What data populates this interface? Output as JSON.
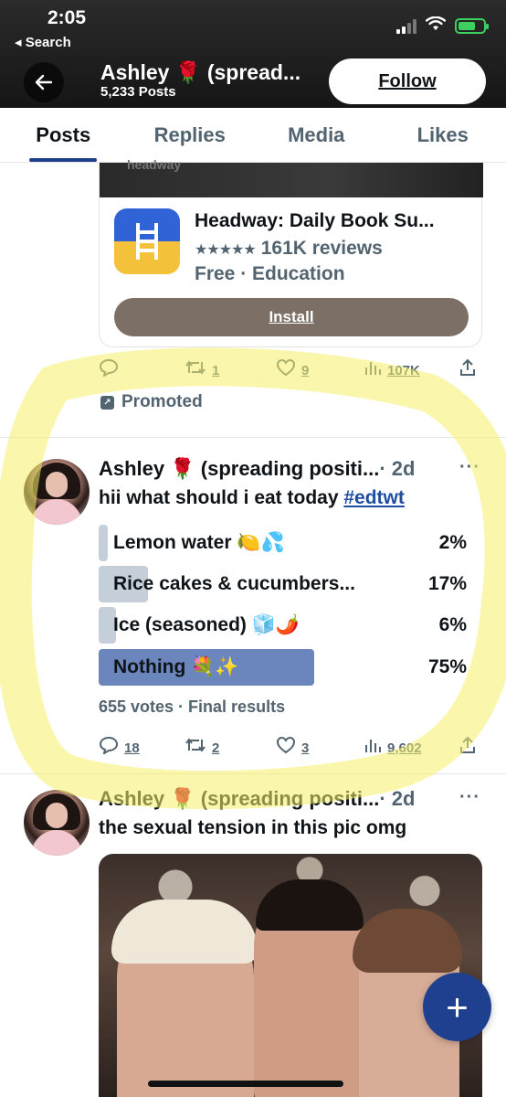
{
  "status_bar": {
    "time": "2:05",
    "back_label": "◂ Search"
  },
  "header": {
    "profile_name": "Ashley 🌹 (spread...",
    "post_count": "5,233 Posts",
    "follow_label": "Follow"
  },
  "tabs": [
    {
      "label": "Posts",
      "active": true
    },
    {
      "label": "Replies",
      "active": false
    },
    {
      "label": "Media",
      "active": false
    },
    {
      "label": "Likes",
      "active": false
    }
  ],
  "ad": {
    "media_label": "headway",
    "app_title": "Headway: Daily Book Su...",
    "rating_stars": "★★★★★",
    "rating_text": "161K reviews",
    "meta": "Free · Education",
    "install_label": "Install",
    "actions": {
      "reposts": "1",
      "likes": "9",
      "views": "107K"
    },
    "promoted_label": "Promoted"
  },
  "tweets": [
    {
      "name": "Ashley 🌹 (spreading positi...",
      "time": "· 2d",
      "more": "···",
      "text": "hii what should i eat today ",
      "hashtag": "#edtwt",
      "poll": {
        "options": [
          {
            "label": "Lemon water 🍋💦",
            "percent": "2%",
            "fraction": 0.02,
            "winner": false
          },
          {
            "label": "Rice cakes & cucumbers...",
            "percent": "17%",
            "fraction": 0.17,
            "winner": false
          },
          {
            "label": "Ice (seasoned) 🧊🌶️",
            "percent": "6%",
            "fraction": 0.06,
            "winner": false
          },
          {
            "label": "Nothing 💐✨",
            "percent": "75%",
            "fraction": 0.75,
            "winner": true
          }
        ],
        "summary": "655 votes · Final results"
      },
      "actions": {
        "replies": "18",
        "reposts": "2",
        "likes": "3",
        "views": "9,602"
      }
    },
    {
      "name": "Ashley 🌹 (spreading positi...",
      "time": "· 2d",
      "more": "···",
      "text": "the sexual tension in this pic omg"
    }
  ],
  "fab_label": "+",
  "colors": {
    "accent": "#1f3f8f",
    "poll_winner": "#6b86bc",
    "poll_other": "#c4cfd9",
    "highlight": "#f6f06a"
  }
}
